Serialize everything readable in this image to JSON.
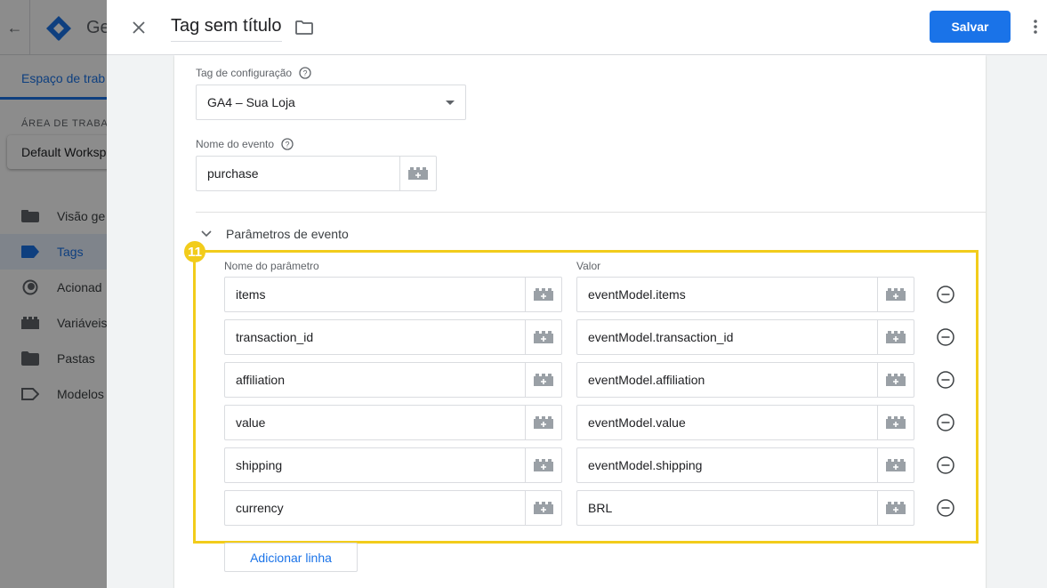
{
  "background": {
    "brand": "Ge",
    "subnav_tab": "Espaço de trab",
    "section_label": "ÁREA DE TRABAL",
    "workspace": "Default Worksp",
    "nav": [
      {
        "label": "Visão ge",
        "icon": "overview-icon"
      },
      {
        "label": "Tags",
        "icon": "tag-icon",
        "active": true
      },
      {
        "label": "Acionad",
        "icon": "trigger-icon"
      },
      {
        "label": "Variáveis",
        "icon": "variable-icon"
      },
      {
        "label": "Pastas",
        "icon": "folder-icon"
      },
      {
        "label": "Modelos",
        "icon": "template-icon"
      }
    ]
  },
  "header": {
    "title": "Tag sem título",
    "save_label": "Salvar"
  },
  "config": {
    "config_tag_label": "Tag de configuração",
    "config_tag_value": "GA4 – Sua Loja",
    "event_name_label": "Nome do evento",
    "event_name_value": "purchase"
  },
  "params": {
    "section_title": "Parâmetros de evento",
    "badge": "11",
    "name_col_label": "Nome do parâmetro",
    "value_col_label": "Valor",
    "rows": [
      {
        "name": "items",
        "value": "eventModel.items"
      },
      {
        "name": "transaction_id",
        "value": "eventModel.transaction_id"
      },
      {
        "name": "affiliation",
        "value": "eventModel.affiliation"
      },
      {
        "name": "value",
        "value": "eventModel.value"
      },
      {
        "name": "shipping",
        "value": "eventModel.shipping"
      },
      {
        "name": "currency",
        "value": "BRL"
      }
    ],
    "add_row_label": "Adicionar linha"
  },
  "colors": {
    "accent": "#1a73e8",
    "highlight": "#f2cc1b"
  }
}
